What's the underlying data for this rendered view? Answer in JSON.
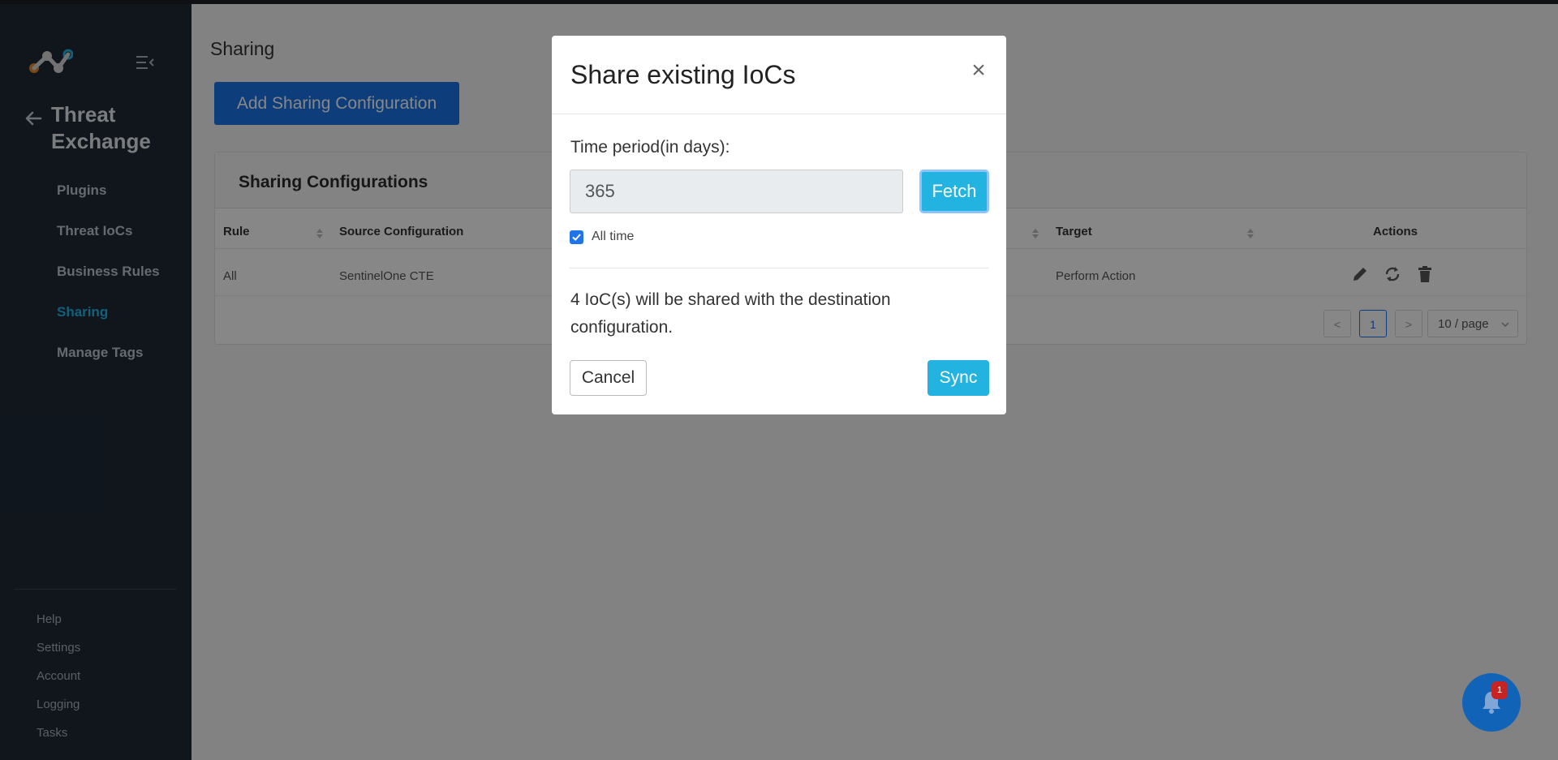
{
  "sidebar": {
    "section_title": "Threat Exchange",
    "nav_items": [
      {
        "label": "Plugins",
        "active": false
      },
      {
        "label": "Threat IoCs",
        "active": false
      },
      {
        "label": "Business Rules",
        "active": false
      },
      {
        "label": "Sharing",
        "active": true
      },
      {
        "label": "Manage Tags",
        "active": false
      }
    ],
    "bottom_items": [
      "Help",
      "Settings",
      "Account",
      "Logging",
      "Tasks"
    ]
  },
  "main": {
    "page_title": "Sharing",
    "add_button_label": "Add Sharing Configuration",
    "card_title": "Sharing Configurations",
    "table": {
      "headers": {
        "rule": "Rule",
        "source": "Source Configuration",
        "target": "Target",
        "actions": "Actions"
      },
      "rows": [
        {
          "rule": "All",
          "source": "SentinelOne CTE",
          "target": "Perform Action"
        }
      ]
    },
    "pagination": {
      "prev": "<",
      "current_page": "1",
      "next": ">",
      "page_size": "10 / page"
    }
  },
  "modal": {
    "title": "Share existing IoCs",
    "close_glyph": "×",
    "field_label": "Time period(in days):",
    "period_value": "365",
    "fetch_label": "Fetch",
    "checkbox_label": "All time",
    "checkbox_checked": true,
    "info_text": "4 IoC(s) will be shared with the destination configuration.",
    "cancel_label": "Cancel",
    "sync_label": "Sync"
  },
  "notifications": {
    "count": "1"
  },
  "colors": {
    "sidebar_bg": "#1f2a36",
    "accent": "#23b6e6",
    "primary": "#1a73e8",
    "sync_button": "#22b3e0",
    "badge": "#c62323"
  }
}
